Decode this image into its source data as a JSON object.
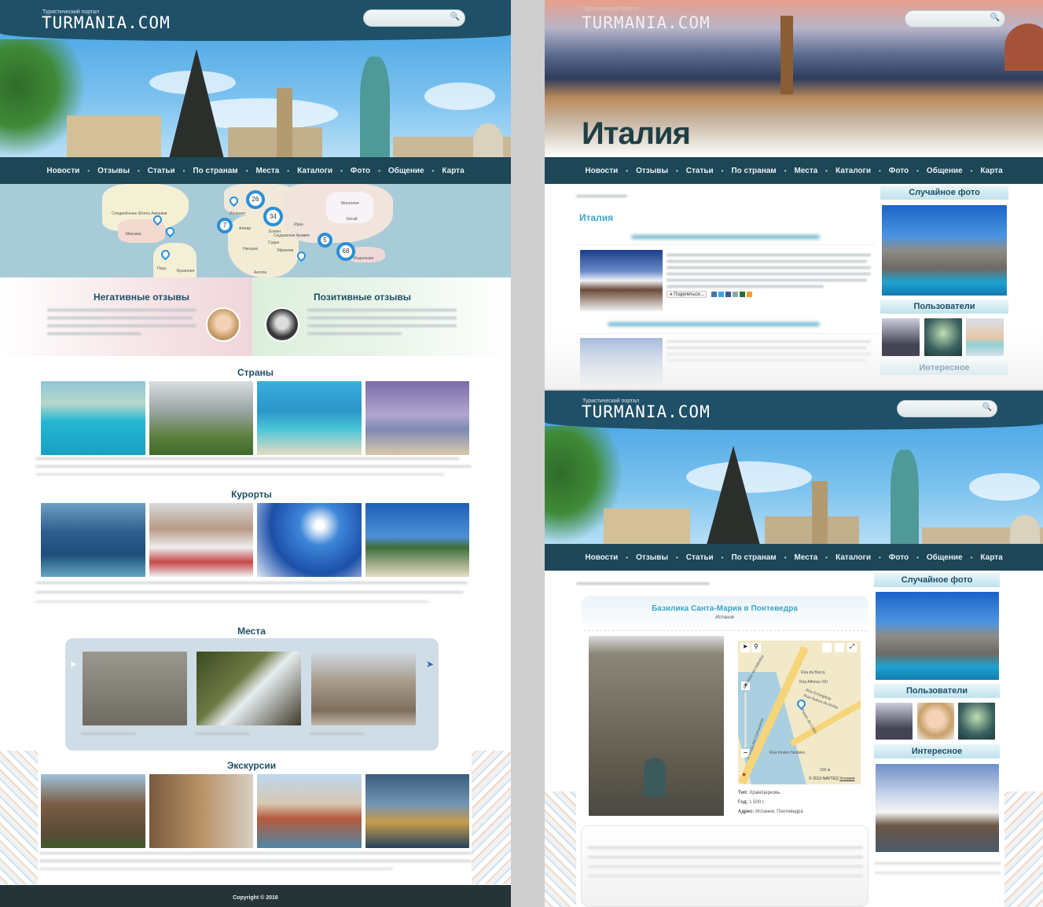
{
  "site": {
    "tagline": "Туристический портал",
    "logo": "TURMANIA.COM",
    "copyright": "Copyright © 2016"
  },
  "nav": [
    "Новости",
    "Отзывы",
    "Статьи",
    "По странам",
    "Места",
    "Каталоги",
    "Фото",
    "Общение",
    "Карта"
  ],
  "map": {
    "clusters": [
      "26",
      "34",
      "7",
      "5",
      "68"
    ],
    "labels": [
      "Соединённые Штаты Америки",
      "Мексика",
      "Испания",
      "Алжир",
      "Египет",
      "Саудовская Аравия",
      "Иран",
      "Монголия",
      "Китай",
      "Судан",
      "Нигерия",
      "Эфиопия",
      "Перу",
      "Бразилия",
      "Ангола",
      "Индонезия"
    ]
  },
  "reviews": {
    "negative": "Негативные отзывы",
    "positive": "Позитивные отзывы"
  },
  "sections": {
    "countries": "Страны",
    "resorts": "Курорты",
    "places": "Места",
    "excursions": "Экскурсии"
  },
  "italy": {
    "hero_title": "Италия",
    "heading": "Италия",
    "share": "Поделиться..."
  },
  "sidebar": {
    "random_photo": "Случайное фото",
    "users": "Пользователи",
    "interesting": "Интересное"
  },
  "place": {
    "title": "Базилика Санта-Мария в Понтеведра",
    "country": "Испания",
    "type_label": "Тип:",
    "type": "Храм/церковь",
    "year_label": "Год:",
    "year": "1 500 г.",
    "address_label": "Адрес:",
    "address": "Испания, Понтеведра",
    "map_streets": [
      "Autopista del Atlántico",
      "Rúa da Barca",
      "Rúa Alfonso XIII",
      "Rúa Echegaray",
      "Rúa Nueva de Arriba",
      "Avenida das Corvaceiras",
      "Paseo de Colón",
      "Rúa Irmáns Nodales"
    ],
    "map_scale": "100 м",
    "map_copyright": "© 2013 NAVTEQ",
    "map_terms": "Условия"
  },
  "colors": {
    "header": "#1f5068",
    "nav": "#1d4656",
    "accent": "#3aa6c8",
    "footer": "#263437"
  }
}
